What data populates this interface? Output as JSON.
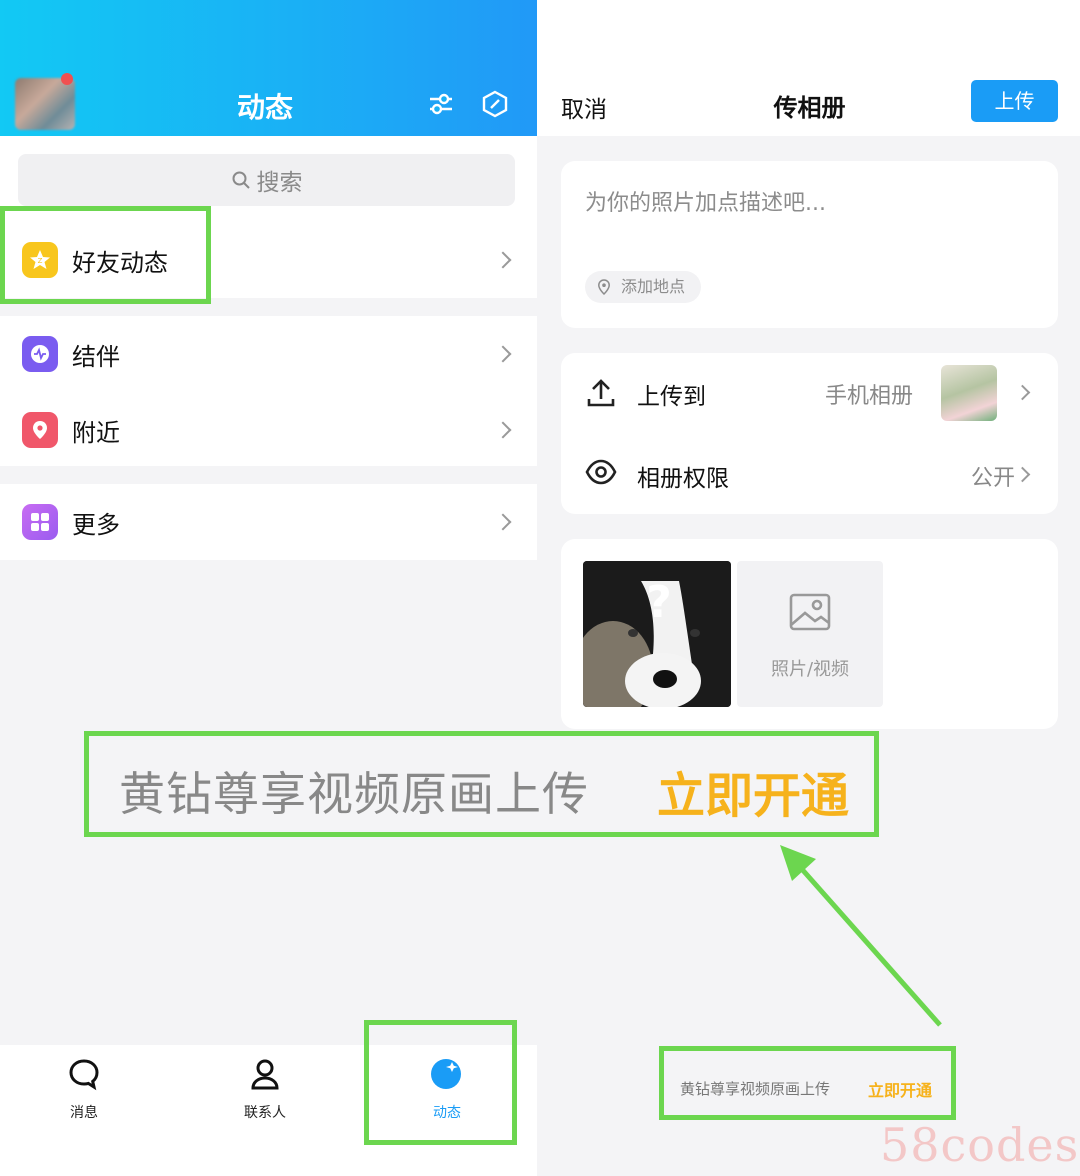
{
  "left": {
    "header": {
      "title": "动态"
    },
    "search": {
      "placeholder": "搜索"
    },
    "menu": [
      {
        "label": "好友动态",
        "icon": "star-icon",
        "color": "#f8c61d"
      },
      {
        "label": "结伴",
        "icon": "pulse-icon",
        "color": "#7a5cf0"
      },
      {
        "label": "附近",
        "icon": "location-pin-icon",
        "color": "#f0576a"
      },
      {
        "label": "更多",
        "icon": "grid-icon",
        "color": "#b966f0"
      }
    ],
    "tabs": [
      {
        "label": "消息",
        "icon": "chat-bubble-icon",
        "active": false
      },
      {
        "label": "联系人",
        "icon": "person-icon",
        "active": false
      },
      {
        "label": "动态",
        "icon": "feed-star-icon",
        "active": true
      }
    ]
  },
  "right": {
    "cancel": "取消",
    "title": "传相册",
    "upload_button": "上传",
    "description_placeholder": "为你的照片加点描述吧...",
    "add_location": "添加地点",
    "upload_to": {
      "label": "上传到",
      "value": "手机相册"
    },
    "permission": {
      "label": "相册权限",
      "value": "公开"
    },
    "add_media_label": "照片/视频"
  },
  "banner": {
    "text": "黄钻尊享视频原画上传",
    "cta": "立即开通"
  },
  "small_banner": {
    "text": "黄钻尊享视频原画上传",
    "cta": "立即开通"
  },
  "watermark": "58codes",
  "colors": {
    "accent": "#1a9cf6",
    "highlight": "#6cd64f",
    "gold": "#f6b21c"
  }
}
